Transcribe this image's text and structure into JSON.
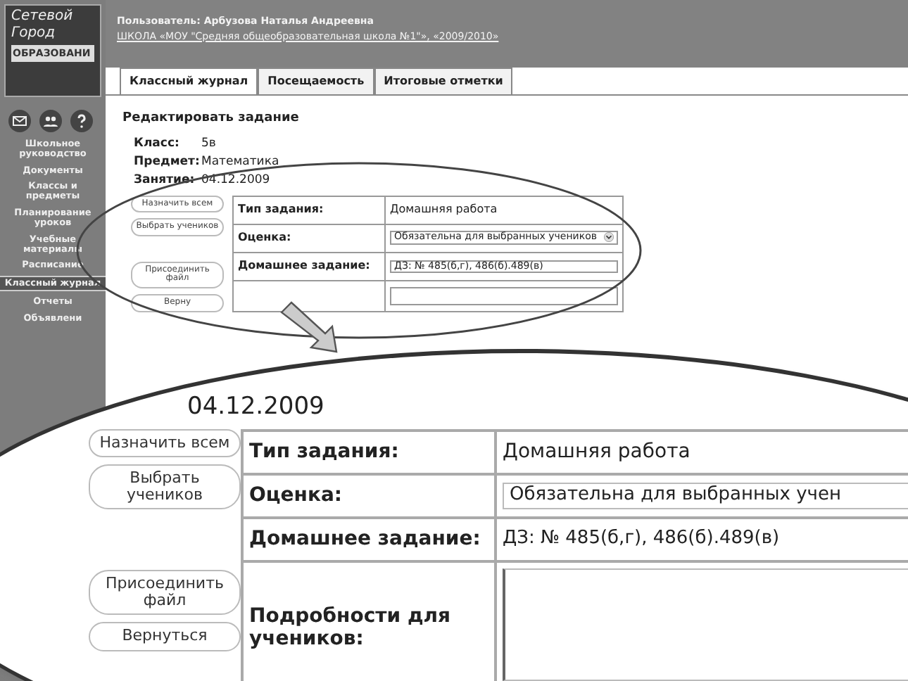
{
  "logo": {
    "line1": "Сетевой",
    "line2": "Город",
    "line3": "ОБРАЗОВАНИ"
  },
  "header": {
    "user": "Пользователь: Арбузова Наталья Андреевна",
    "school": "ШКОЛА «МОУ \"Средняя общеобразовательная школа №1\"», «2009/2010»"
  },
  "sidebar": {
    "items": [
      {
        "label": "Школьное руководство",
        "selected": false
      },
      {
        "label": "Документы",
        "selected": false
      },
      {
        "label": "Классы и предметы",
        "selected": false
      },
      {
        "label": "Планирование уроков",
        "selected": false
      },
      {
        "label": "Учебные материалы",
        "selected": false
      },
      {
        "label": "Расписание",
        "selected": false
      },
      {
        "label": "Классный журнал",
        "selected": true
      },
      {
        "label": "Отчеты",
        "selected": false
      },
      {
        "label": "Объявлени",
        "selected": false
      }
    ]
  },
  "tabs": [
    {
      "label": "Классный журнал",
      "selected": true
    },
    {
      "label": "Посещаемость",
      "selected": false
    },
    {
      "label": "Итоговые отметки",
      "selected": false
    }
  ],
  "page": {
    "title": "Редактировать задание",
    "fields": [
      {
        "label": "Класс:",
        "value": "5в"
      },
      {
        "label": "Предмет:",
        "value": "Математика"
      },
      {
        "label": "Занятие:",
        "value": "04.12.2009"
      }
    ]
  },
  "form": {
    "buttons": [
      "Назначить всем",
      "Выбрать учеников",
      "Присоединить файл",
      "Верну"
    ],
    "rows": [
      {
        "kind": "text",
        "label": "Тип задания:",
        "value": "Домашняя работа"
      },
      {
        "kind": "select",
        "label": "Оценка:",
        "value": "Обязательна для выбранных учеников"
      },
      {
        "kind": "input",
        "label": "Домашнее задание:",
        "value": "ДЗ: № 485(б,г), 486(б).489(в)"
      },
      {
        "kind": "textarea"
      }
    ]
  },
  "zoom": {
    "date": "04.12.2009",
    "buttons": [
      "Назначить всем",
      "Выбрать учеников",
      "Присоединить файл",
      "Вернуться"
    ],
    "rows": [
      {
        "kind": "text",
        "label": "Тип задания:",
        "value": "Домашняя работа"
      },
      {
        "kind": "select",
        "label": "Оценка:",
        "value": "Обязательна для выбранных учен"
      },
      {
        "kind": "input",
        "label": "Домашнее задание:",
        "value": "ДЗ: № 485(б,г), 486(б).489(в)"
      },
      {
        "kind": "textarea",
        "label": "Подробности для учеников:"
      }
    ]
  }
}
